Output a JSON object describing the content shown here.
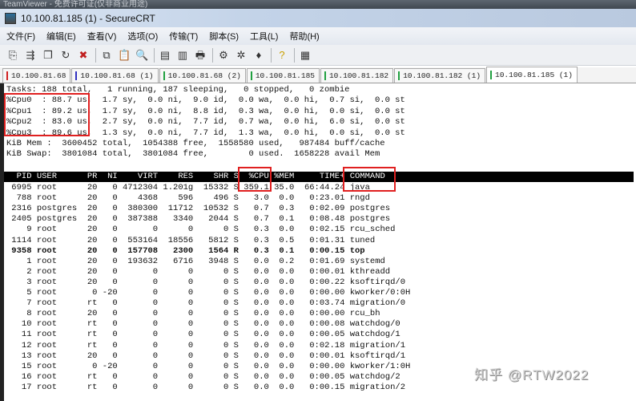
{
  "teamviewer_bar": "TeamViewer - 免费许可证(仅非商业用途)",
  "window_title": "10.100.81.185 (1) - SecureCRT",
  "menu": [
    "文件(F)",
    "编辑(E)",
    "查看(V)",
    "选项(O)",
    "传输(T)",
    "脚本(S)",
    "工具(L)",
    "帮助(H)"
  ],
  "toolbar_icons": [
    "connect-icon",
    "quick-connect-icon",
    "connect-tab-icon",
    "reconnect-icon",
    "disconnect-icon",
    "copy-icon",
    "paste-icon",
    "find-icon",
    "print-setup-icon",
    "print-selection-icon",
    "print-icon",
    "session-options-icon",
    "global-options-icon",
    "keymap-icon",
    "help-icon",
    "log-icon"
  ],
  "tabs": [
    {
      "label": "10.100.81.68",
      "color": "#d02020"
    },
    {
      "label": "10.100.81.68 (1)",
      "color": "#3030c0"
    },
    {
      "label": "10.100.81.68 (2)",
      "color": "#20a040"
    },
    {
      "label": "10.100.81.185",
      "color": "#20a040"
    },
    {
      "label": "10.100.81.182",
      "color": "#20a040"
    },
    {
      "label": "10.100.81.182 (1)",
      "color": "#20a040"
    },
    {
      "label": "10.100.81.185 (1)",
      "color": "#20a040",
      "active": true
    }
  ],
  "summary": [
    "Tasks: 188 total,   1 running, 187 sleeping,   0 stopped,   0 zombie",
    "%Cpu0  : 88.7 us,  1.7 sy,  0.0 ni,  9.0 id,  0.0 wa,  0.0 hi,  0.7 si,  0.0 st",
    "%Cpu1  : 89.2 us,  1.7 sy,  0.0 ni,  8.8 id,  0.3 wa,  0.0 hi,  0.0 si,  0.0 st",
    "%Cpu2  : 83.0 us,  2.7 sy,  0.0 ni,  7.7 id,  0.7 wa,  0.0 hi,  6.0 si,  0.0 st",
    "%Cpu3  : 89.6 us,  1.3 sy,  0.0 ni,  7.7 id,  1.3 wa,  0.0 hi,  0.0 si,  0.0 st",
    "KiB Mem :  3600452 total,  1054388 free,  1558580 used,   987484 buff/cache",
    "KiB Swap:  3801084 total,  3801084 free,        0 used.  1658228 avail Mem"
  ],
  "columns": [
    "PID",
    "USER",
    "PR",
    "NI",
    "VIRT",
    "RES",
    "SHR",
    "S",
    "%CPU",
    "%MEM",
    "TIME+",
    "COMMAND"
  ],
  "processes": [
    [
      "6995",
      "root",
      "20",
      "0",
      "4712304",
      "1.201g",
      "15332",
      "S",
      "359.1",
      "35.0",
      "66:44.24",
      "java"
    ],
    [
      "788",
      "root",
      "20",
      "0",
      "4368",
      "596",
      "496",
      "S",
      "3.0",
      "0.0",
      "0:23.01",
      "rngd"
    ],
    [
      "2316",
      "postgres",
      "20",
      "0",
      "380300",
      "11712",
      "10532",
      "S",
      "0.7",
      "0.3",
      "0:02.09",
      "postgres"
    ],
    [
      "2405",
      "postgres",
      "20",
      "0",
      "387388",
      "3340",
      "2044",
      "S",
      "0.7",
      "0.1",
      "0:08.48",
      "postgres"
    ],
    [
      "9",
      "root",
      "20",
      "0",
      "0",
      "0",
      "0",
      "S",
      "0.3",
      "0.0",
      "0:02.15",
      "rcu_sched"
    ],
    [
      "1114",
      "root",
      "20",
      "0",
      "553164",
      "18556",
      "5812",
      "S",
      "0.3",
      "0.5",
      "0:01.31",
      "tuned"
    ],
    [
      "9358",
      "root",
      "20",
      "0",
      "157708",
      "2300",
      "1564",
      "R",
      "0.3",
      "0.1",
      "0:00.15",
      "top"
    ],
    [
      "1",
      "root",
      "20",
      "0",
      "193632",
      "6716",
      "3948",
      "S",
      "0.0",
      "0.2",
      "0:01.69",
      "systemd"
    ],
    [
      "2",
      "root",
      "20",
      "0",
      "0",
      "0",
      "0",
      "S",
      "0.0",
      "0.0",
      "0:00.01",
      "kthreadd"
    ],
    [
      "3",
      "root",
      "20",
      "0",
      "0",
      "0",
      "0",
      "S",
      "0.0",
      "0.0",
      "0:00.22",
      "ksoftirqd/0"
    ],
    [
      "5",
      "root",
      "0",
      "-20",
      "0",
      "0",
      "0",
      "S",
      "0.0",
      "0.0",
      "0:00.00",
      "kworker/0:0H"
    ],
    [
      "7",
      "root",
      "rt",
      "0",
      "0",
      "0",
      "0",
      "S",
      "0.0",
      "0.0",
      "0:03.74",
      "migration/0"
    ],
    [
      "8",
      "root",
      "20",
      "0",
      "0",
      "0",
      "0",
      "S",
      "0.0",
      "0.0",
      "0:00.00",
      "rcu_bh"
    ],
    [
      "10",
      "root",
      "rt",
      "0",
      "0",
      "0",
      "0",
      "S",
      "0.0",
      "0.0",
      "0:00.08",
      "watchdog/0"
    ],
    [
      "11",
      "root",
      "rt",
      "0",
      "0",
      "0",
      "0",
      "S",
      "0.0",
      "0.0",
      "0:00.05",
      "watchdog/1"
    ],
    [
      "12",
      "root",
      "rt",
      "0",
      "0",
      "0",
      "0",
      "S",
      "0.0",
      "0.0",
      "0:02.18",
      "migration/1"
    ],
    [
      "13",
      "root",
      "20",
      "0",
      "0",
      "0",
      "0",
      "S",
      "0.0",
      "0.0",
      "0:00.01",
      "ksoftirqd/1"
    ],
    [
      "15",
      "root",
      "0",
      "-20",
      "0",
      "0",
      "0",
      "S",
      "0.0",
      "0.0",
      "0:00.00",
      "kworker/1:0H"
    ],
    [
      "16",
      "root",
      "rt",
      "0",
      "0",
      "0",
      "0",
      "S",
      "0.0",
      "0.0",
      "0:00.05",
      "watchdog/2"
    ],
    [
      "17",
      "root",
      "rt",
      "0",
      "0",
      "0",
      "0",
      "S",
      "0.0",
      "0.0",
      "0:00.15",
      "migration/2"
    ]
  ],
  "bold_pid": "9358",
  "highlight_color": "#e02020",
  "watermark": "知乎 @RTW2022"
}
